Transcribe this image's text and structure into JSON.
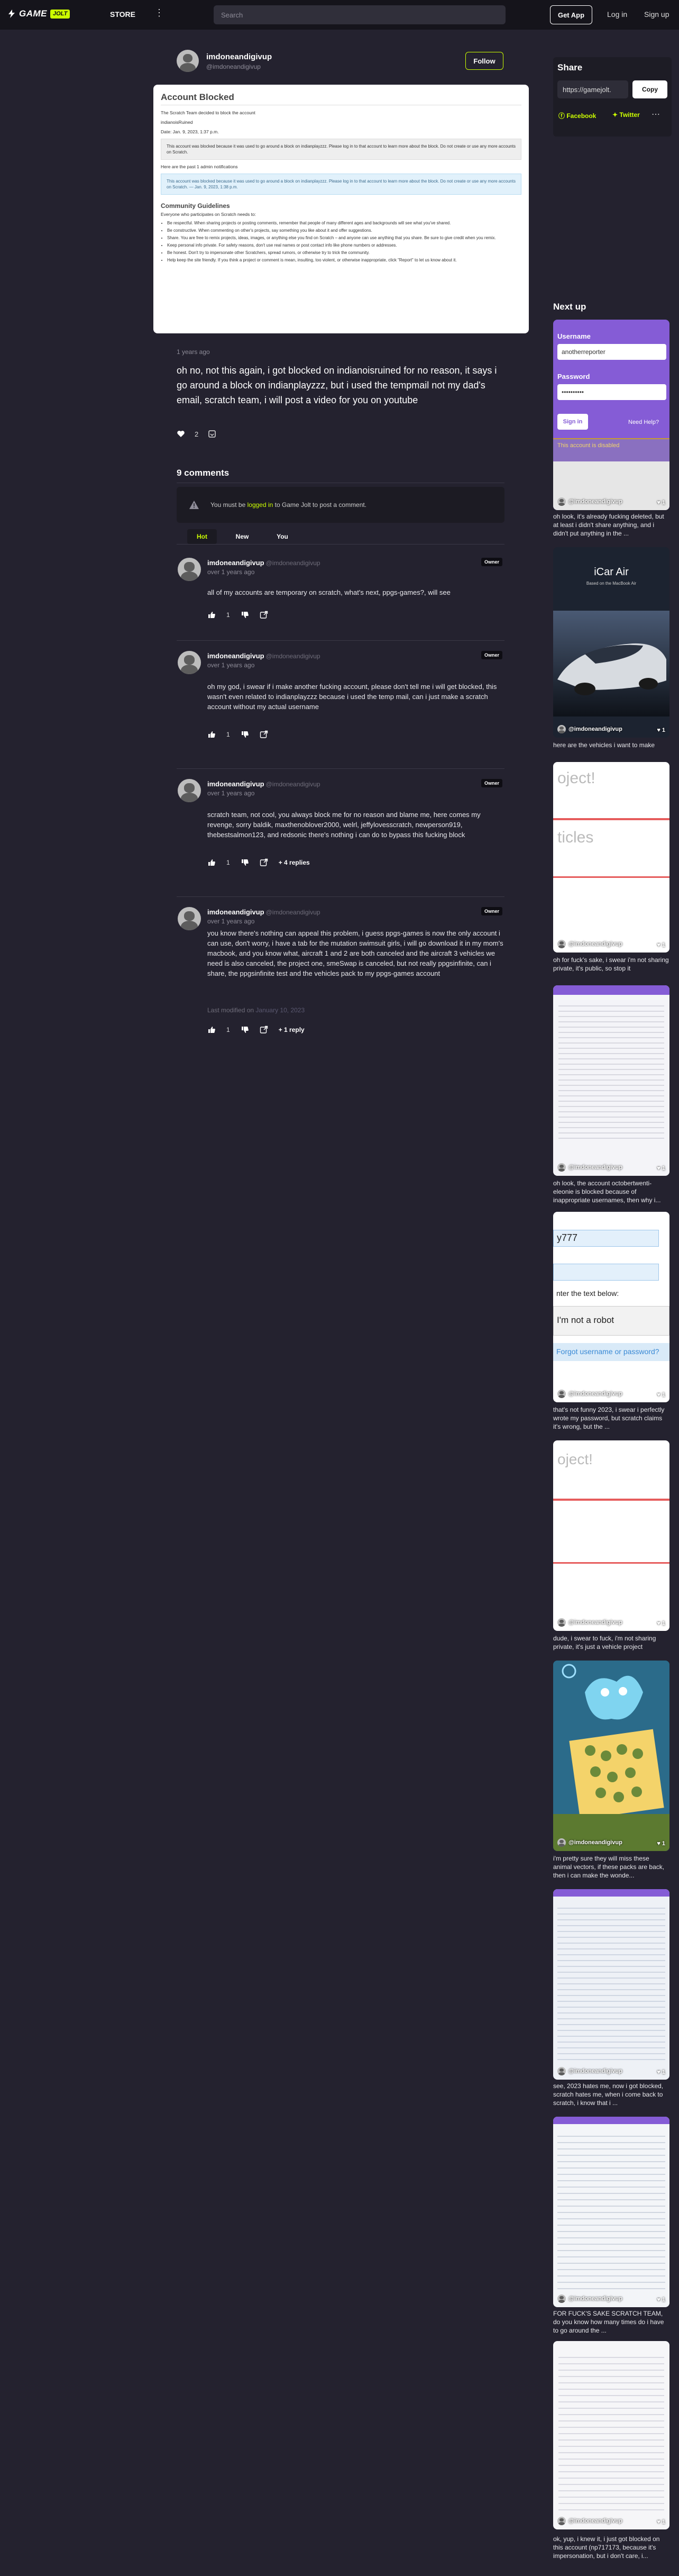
{
  "topbar": {
    "logo_text": "GAME",
    "logo_badge": "JOLT",
    "store": "STORE",
    "more": "⋮",
    "search_placeholder": "Search",
    "get_app": "Get App",
    "login": "Log in",
    "signup": "Sign up"
  },
  "post": {
    "author": "imdoneandigivup",
    "handle": "@imdoneandigivup",
    "follow": "Follow",
    "age": "1 years ago",
    "body": "oh no, not this again, i got blocked on indianoisruined for no reason, it says i go around a block on indianplayzzz, but i used the tempmail not my dad's email, scratch team, i will post a video for you on youtube",
    "likes": "2",
    "image": {
      "title": "Account Blocked",
      "intro": "The Scratch Team decided to block the account",
      "account": "indianoisRuined",
      "date": "Date: Jan. 9, 2023, 1:37 p.m.",
      "reason": "This account was blocked because it was used to go around a block on indianplayzzz. Please log in to that account to learn more about the block. Do not create or use any more accounts on Scratch.",
      "admin_note": "Here are the past 1 admin notifications",
      "past_notice": "This account was blocked because it was used to go around a block on indianplayzzz. Please log in to that account to learn more about the block. Do not create or use any more accounts on Scratch. — Jan. 9, 2023, 1:38 p.m.",
      "guidelines_title": "Community Guidelines",
      "guidelines_intro": "Everyone who participates on Scratch needs to:",
      "guidelines": [
        "Be respectful. When sharing projects or posting comments, remember that people of many different ages and backgrounds will see what you've shared.",
        "Be constructive. When commenting on other's projects, say something you like about it and offer suggestions.",
        "Share. You are free to remix projects, ideas, images, or anything else you find on Scratch – and anyone can use anything that you share. Be sure to give credit when you remix.",
        "Keep personal info private. For safety reasons, don't use real names or post contact info like phone numbers or addresses.",
        "Be honest. Don't try to impersonate other Scratchers, spread rumors, or otherwise try to trick the community.",
        "Help keep the site friendly. If you think a project or comment is mean, insulting, too violent, or otherwise inappropriate, click \"Report\" to let us know about it."
      ]
    }
  },
  "comments_section": {
    "title": "9 comments",
    "login_prefix": "You must be ",
    "login_link": "logged in",
    "login_suffix": " to Game Jolt to post a comment.",
    "tabs": [
      "Hot",
      "New",
      "You"
    ]
  },
  "comments": [
    {
      "author": "imdoneandigivup",
      "handle": "@imdoneandigivup",
      "age": "over 1 years ago",
      "badge": "Owner",
      "body": "all of my accounts are temporary on scratch, what's next, ppgs-games?, will see",
      "likes": "1"
    },
    {
      "author": "imdoneandigivup",
      "handle": "@imdoneandigivup",
      "age": "over 1 years ago",
      "badge": "Owner",
      "body": "oh my god, i swear if i make another fucking account, please don't tell me i will get blocked, this wasn't even related to indianplayzzz because i used the temp mail, can i just make a scratch account without my actual username",
      "likes": "1"
    },
    {
      "author": "imdoneandigivup",
      "handle": "@imdoneandigivup",
      "age": "over 1 years ago",
      "badge": "Owner",
      "body": "scratch team, not cool, you always block me for no reason and blame me, here comes my revenge, sorry baldik, maxthenoblover2000, welrl, jeffylovesscratch, newperson919, thebestsalmon123, and redsonic there's nothing i can do to bypass this fucking block",
      "likes": "1",
      "replies": "+ 4 replies"
    },
    {
      "author": "imdoneandigivup",
      "handle": "@imdoneandigivup",
      "age": "over 1 years ago",
      "badge": "Owner",
      "body": "you know there's nothing can appeal this problem, i guess ppgs-games is now the only account i can use, don't worry, i have a tab for the mutation swimsuit girls, i will go download it in my mom's macbook, and you know what, aircraft 1 and 2 are both canceled and the aircraft 3 vehicles we need is also canceled, the project one, smeSwap is canceled, but not really ppgsinfinite, can i share, the ppgsinfinite test and the vehicles pack to my ppgs-games account",
      "modified_label": "Last modified on",
      "modified_date": "January 10, 2023",
      "likes": "1",
      "replies": "+ 1 reply"
    }
  ],
  "share": {
    "title": "Share",
    "url": "https://gamejolt.",
    "copy": "Copy",
    "facebook": "Facebook",
    "twitter": "Twitter",
    "more": "⋯"
  },
  "next_up": {
    "title": "Next up",
    "cards": [
      {
        "user": "@imdoneandigivup",
        "likes": "1",
        "caption": "oh look, it's already fucking deleted, but at least i didn't share anything, and i didn't put anything in the ...",
        "username_label": "Username",
        "username_value": "anotherreporter",
        "password_label": "Password",
        "password_value": "••••••••••",
        "signin": "Sign in",
        "help": "Need Help?",
        "disabled": "This account is disabled"
      },
      {
        "user": "@imdoneandigivup",
        "likes": "1",
        "caption": "here are the vehicles i want to make",
        "title": "iCar Air",
        "subtitle": "Based on the MacBook Air"
      },
      {
        "user": "@imdoneandigivup",
        "likes": "1",
        "caption": "oh for fuck's sake, i swear i'm not sharing private, it's public, so stop it",
        "text1": "oject!",
        "text2": "ticles"
      },
      {
        "user": "@imdoneandigivup",
        "likes": "1",
        "caption": "oh look, the account octobertwenti-eleonie is blocked because of inappropriate usernames, then why i..."
      },
      {
        "user": "@imdoneandigivup",
        "likes": "1",
        "caption": "that's not funny 2023, i swear i perfectly wrote my password, but scratch claims it's wrong, but the ...",
        "field": "y777",
        "captcha_text": "nter the text below:",
        "robot": "I'm not a robot",
        "forgot": "Forgot username or password?"
      },
      {
        "user": "@imdoneandigivup",
        "likes": "1",
        "caption": "dude, i swear to fuck, i'm not sharing private, it's just a vehicle project",
        "text1": "oject!"
      },
      {
        "user": "@imdoneandigivup",
        "likes": "1",
        "caption": "i'm pretty sure they will miss these animal vectors, if these packs are back, then i can make the wonde..."
      },
      {
        "user": "@imdoneandigivup",
        "likes": "1",
        "caption": "see, 2023 hates me, now i got blocked, scratch hates me, when i come back to scratch, i know that i ..."
      },
      {
        "user": "@imdoneandigivup",
        "likes": "1",
        "caption": "FOR FUCK'S SAKE SCRATCH TEAM, do you know how many times do i have to go around the ..."
      },
      {
        "user": "@imdoneandigivup",
        "likes": "1",
        "caption": "ok, yup, i knew it, i just got blocked on this account (np717173, because it's impersonation, but i don't care, i..."
      }
    ]
  },
  "colors": {
    "background": "#24222f",
    "topbar": "#15141b",
    "accent": "#ccff00"
  }
}
